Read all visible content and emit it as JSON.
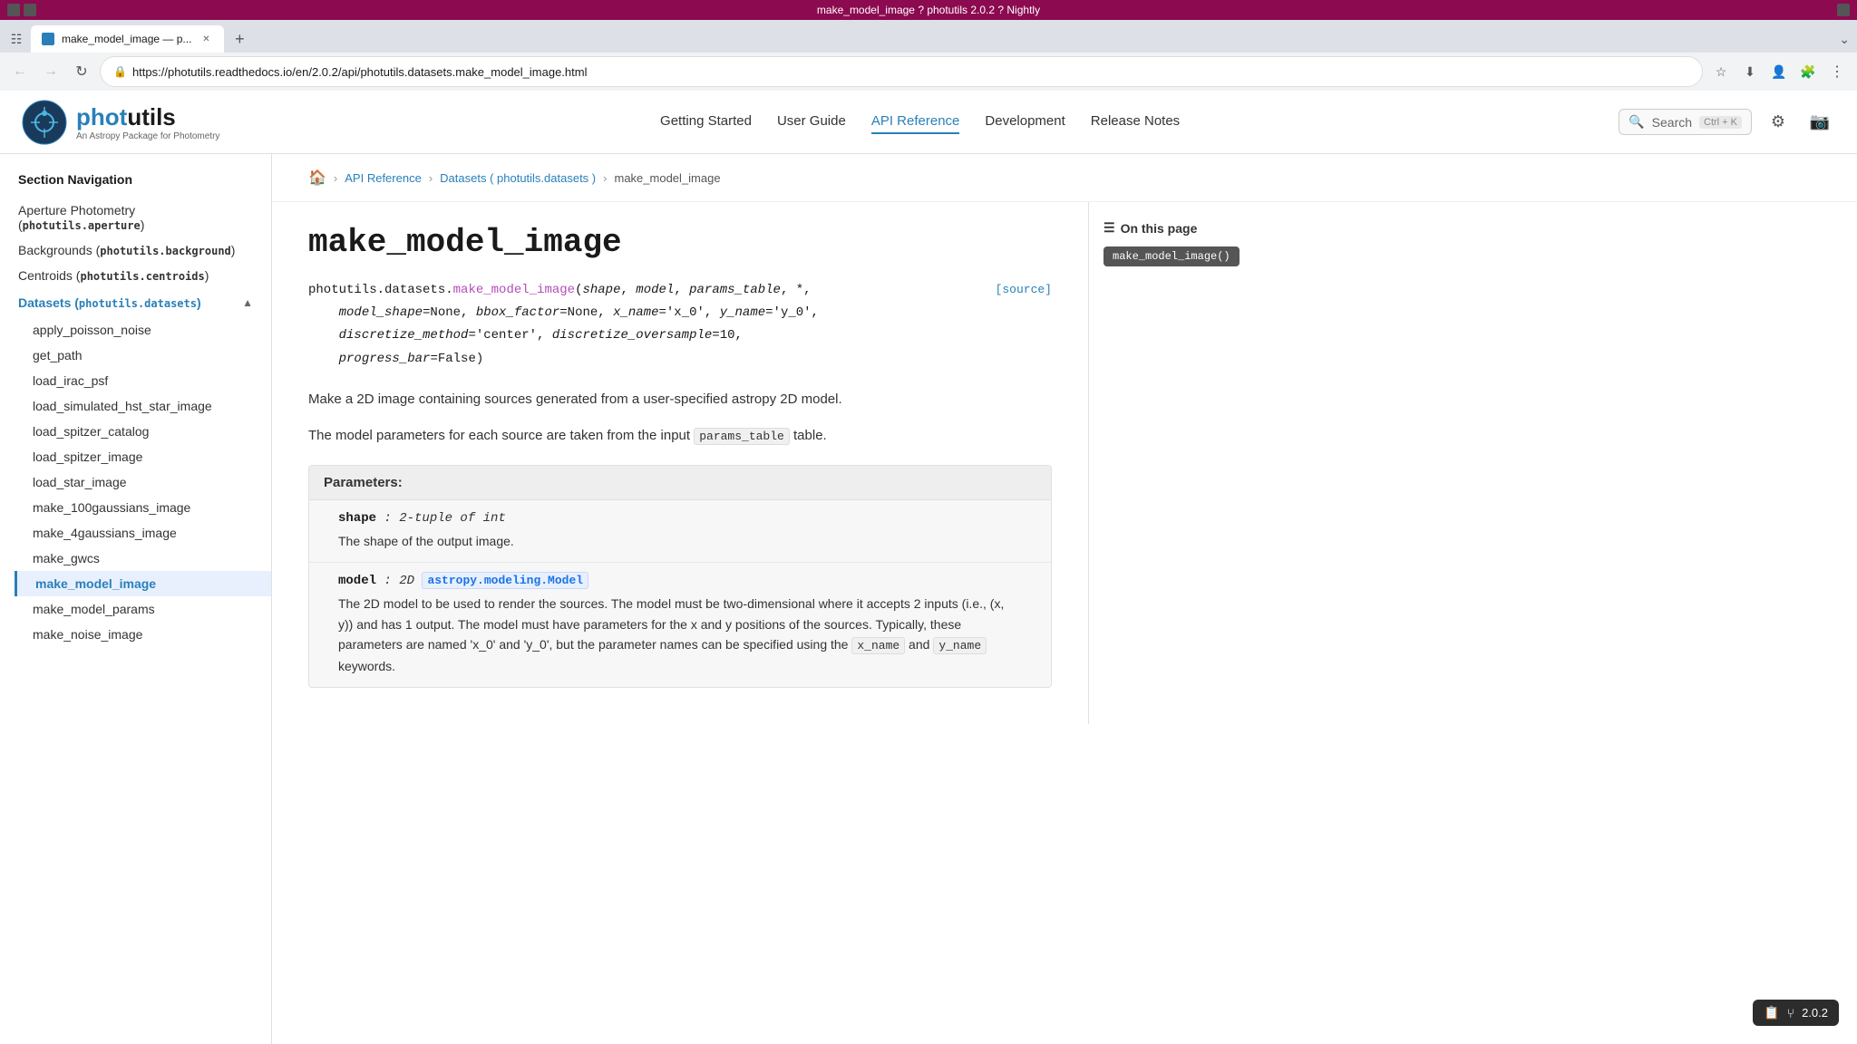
{
  "titlebar": {
    "text": "make_model_image ? photutils 2.0.2 ? Nightly"
  },
  "tab": {
    "label": "make_model_image — p...",
    "url": "https://photutils.readthedocs.io/en/2.0.2/api/photutils.datasets.make_model_image.html"
  },
  "nav": {
    "back_title": "Back",
    "forward_title": "Forward",
    "refresh_title": "Refresh"
  },
  "header": {
    "logo": {
      "text_phot": "phot",
      "text_utils": "utils",
      "subtext": "An Astropy Package for Photometry"
    },
    "nav_items": [
      {
        "label": "Getting Started",
        "active": false
      },
      {
        "label": "User Guide",
        "active": false
      },
      {
        "label": "API Reference",
        "active": true
      },
      {
        "label": "Development",
        "active": false
      },
      {
        "label": "Release Notes",
        "active": false
      }
    ],
    "search": {
      "placeholder": "Search",
      "shortcut": "Ctrl + K"
    }
  },
  "sidebar": {
    "section_title": "Section Navigation",
    "items": [
      {
        "label": "Aperture Photometry (",
        "code": "photutils.aperture",
        "suffix": ")",
        "active": false,
        "indent": 0
      },
      {
        "label": "Backgrounds (",
        "code": "photutils.background",
        "suffix": ")",
        "active": false,
        "indent": 0
      },
      {
        "label": "Centroids (",
        "code": "photutils.centroids",
        "suffix": ")",
        "active": false,
        "indent": 0
      },
      {
        "label": "Datasets (",
        "code": "photutils.datasets",
        "suffix": ")",
        "active": false,
        "indent": 0,
        "group": true
      },
      {
        "label": "apply_poisson_noise",
        "active": false,
        "indent": 1
      },
      {
        "label": "get_path",
        "active": false,
        "indent": 1
      },
      {
        "label": "load_irac_psf",
        "active": false,
        "indent": 1
      },
      {
        "label": "load_simulated_hst_star_image",
        "active": false,
        "indent": 1
      },
      {
        "label": "load_spitzer_catalog",
        "active": false,
        "indent": 1
      },
      {
        "label": "load_spitzer_image",
        "active": false,
        "indent": 1
      },
      {
        "label": "load_star_image",
        "active": false,
        "indent": 1
      },
      {
        "label": "make_100gaussians_image",
        "active": false,
        "indent": 1
      },
      {
        "label": "make_4gaussians_image",
        "active": false,
        "indent": 1
      },
      {
        "label": "make_gwcs",
        "active": false,
        "indent": 1
      },
      {
        "label": "make_model_image",
        "active": true,
        "indent": 1
      },
      {
        "label": "make_model_params",
        "active": false,
        "indent": 1
      },
      {
        "label": "make_noise_image",
        "active": false,
        "indent": 1
      }
    ]
  },
  "breadcrumb": {
    "home": "🏠",
    "items": [
      {
        "label": "API Reference",
        "href": "#"
      },
      {
        "label": "Datasets ( photutils.datasets )",
        "href": "#"
      },
      {
        "label": "make_model_image",
        "href": "#"
      }
    ]
  },
  "page": {
    "title": "make_model_image",
    "function_signature": {
      "module": "photutils.datasets.",
      "func_name": "make_model_image",
      "params": "shape, model, params_table, *, model_shape=None, bbox_factor=None, x_name='x_0', y_name='y_0', discretize_method='center', discretize_oversample=10, progress_bar=False"
    },
    "source_link": "[source]",
    "description1": "Make a 2D image containing sources generated from a user-specified astropy 2D model.",
    "description2_pre": "The model parameters for each source are taken from the input ",
    "description2_code": "params_table",
    "description2_post": " table.",
    "params_header": "Parameters:",
    "params": [
      {
        "name": "shape",
        "type_text": " : 2-tuple of int",
        "desc": "The shape of the output image."
      },
      {
        "name": "model",
        "type_pre": " : 2D ",
        "type_link": "astropy.modeling.Model",
        "desc": "The 2D model to be used to render the sources. The model must be two-dimensional where it accepts 2 inputs (i.e., (x, y)) and has 1 output. The model must have parameters for the x and y positions of the sources. Typically, these parameters are named 'x_0' and 'y_0', but the parameter names can be specified using the ",
        "desc_code1": "x_name",
        "desc_middle": " and ",
        "desc_code2": "y_name",
        "desc_end": " keywords."
      }
    ]
  },
  "on_this_page": {
    "title": "On this page",
    "items": [
      {
        "label": "make_model_image()"
      }
    ]
  },
  "version_badge": {
    "text": "2.0.2"
  }
}
